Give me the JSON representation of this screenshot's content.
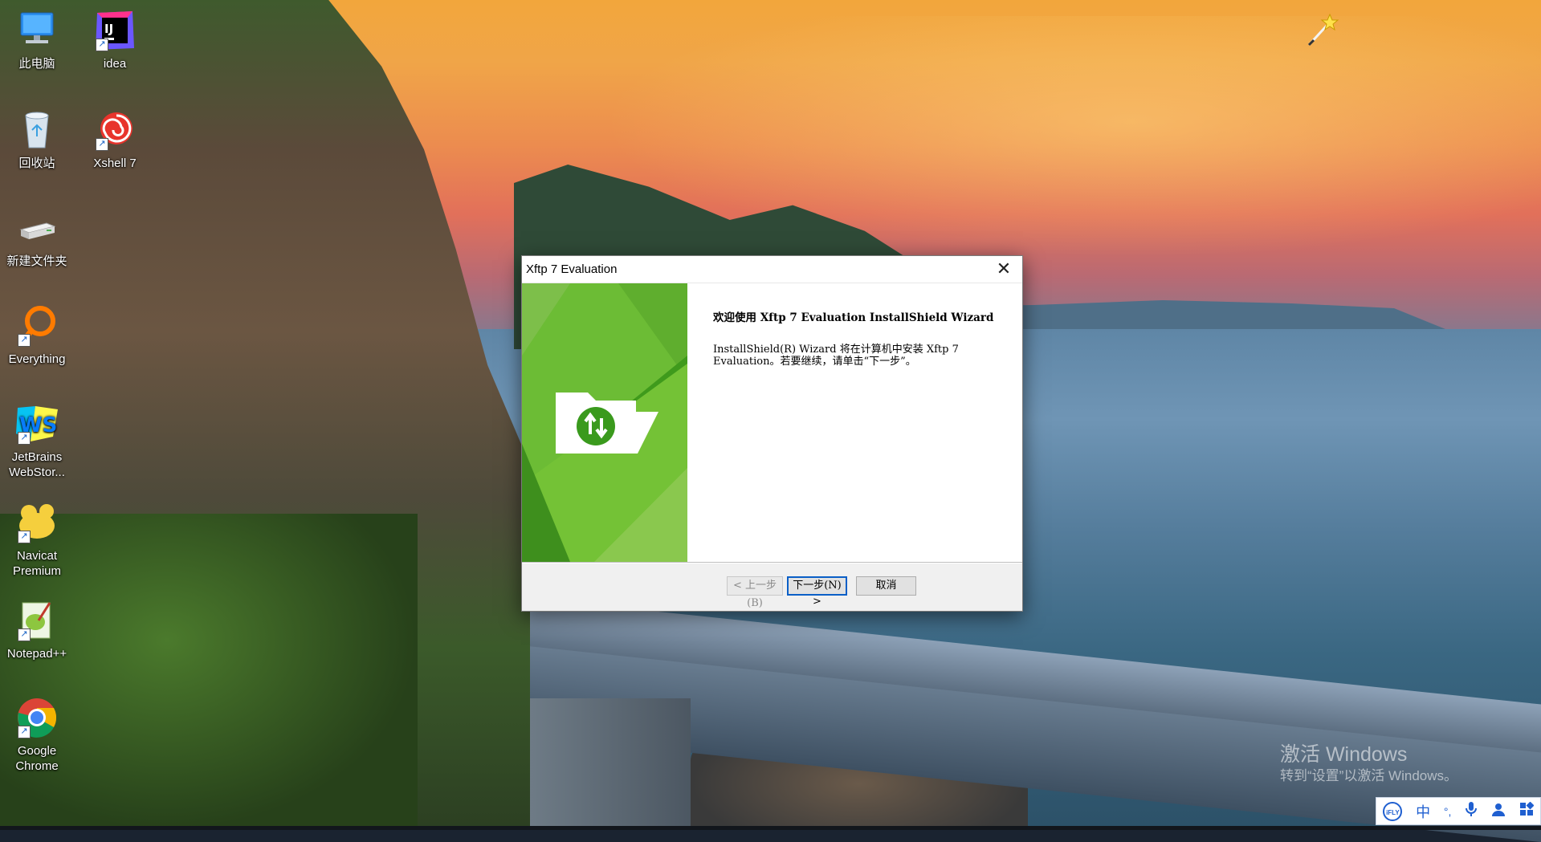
{
  "desktop": {
    "icons": [
      {
        "label": "此电脑"
      },
      {
        "label": "idea"
      },
      {
        "label": "回收站"
      },
      {
        "label": "Xshell 7"
      },
      {
        "label": "新建文件夹"
      },
      {
        "label": "Everything"
      },
      {
        "label": "JetBrains WebStor..."
      },
      {
        "label": "Navicat Premium"
      },
      {
        "label": "Notepad++"
      },
      {
        "label": "Google Chrome"
      }
    ]
  },
  "dialog": {
    "title": "Xftp 7 Evaluation",
    "close_glyph": "✕",
    "heading": "欢迎使用 Xftp 7 Evaluation InstallShield Wizard",
    "description": "InstallShield(R) Wizard 将在计算机中安装 Xftp 7 Evaluation。若要继续，请单击“下一步”。",
    "buttons": {
      "back": "< 上一步(B)",
      "next": "下一步(N) >",
      "cancel": "取消"
    }
  },
  "watermark": {
    "line1": "激活 Windows",
    "line2": "转到“设置”以激活 Windows。"
  },
  "ime_toolbar": {
    "logo": "iFLY",
    "mode": "中",
    "punct": "°,",
    "icons": [
      "microphone-icon",
      "user-icon",
      "grid-icon"
    ]
  },
  "colors": {
    "banner_green": "#5fae2e",
    "default_button_border": "#0a5fc7",
    "ime_blue": "#1f5fd0"
  }
}
